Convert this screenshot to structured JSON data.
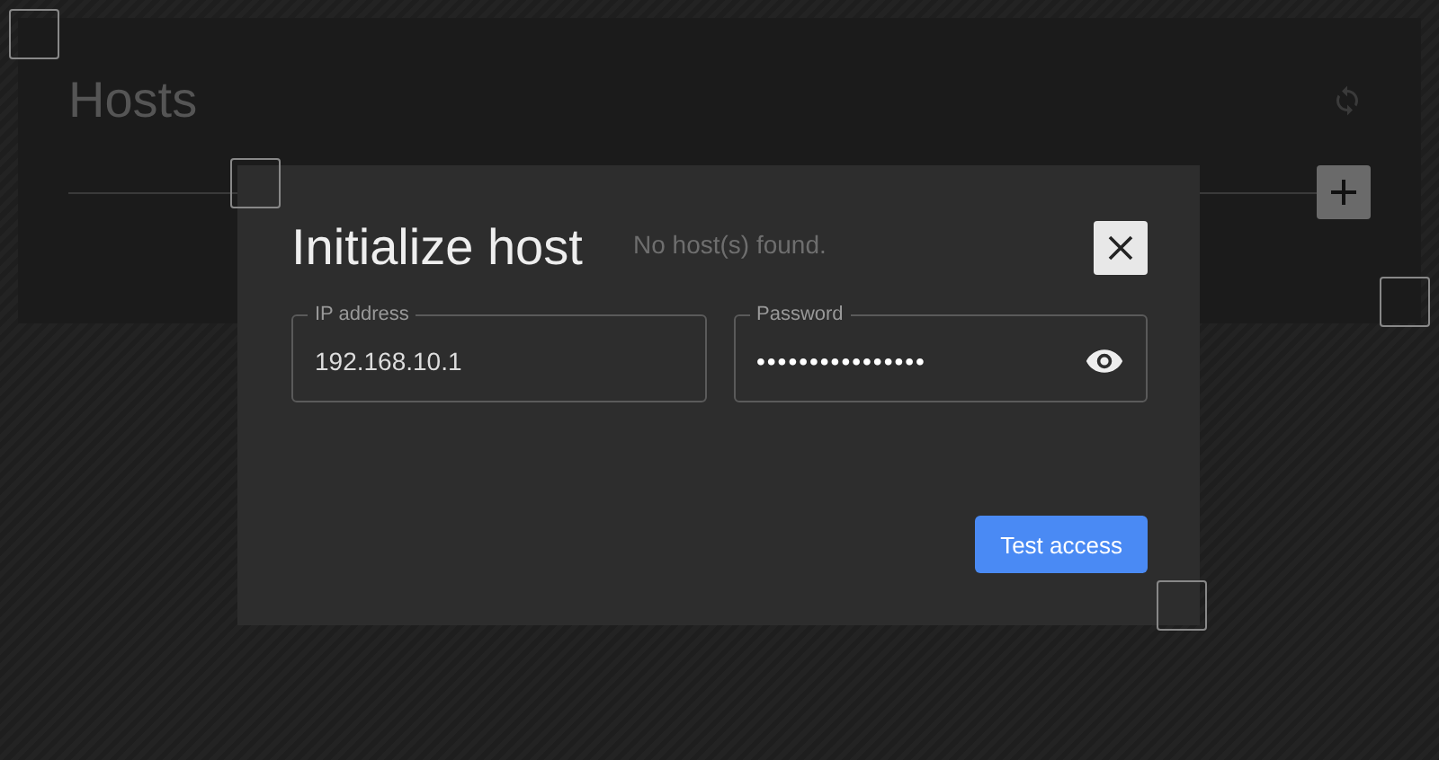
{
  "page": {
    "title": "Hosts",
    "empty_message": "No host(s) found."
  },
  "dialog": {
    "title": "Initialize host",
    "fields": [
      {
        "kind": "text",
        "label": "IP address",
        "value": "192.168.10.1"
      },
      {
        "kind": "password",
        "label": "Password",
        "value": "••••••••••••••••"
      }
    ],
    "button": "Test access"
  }
}
